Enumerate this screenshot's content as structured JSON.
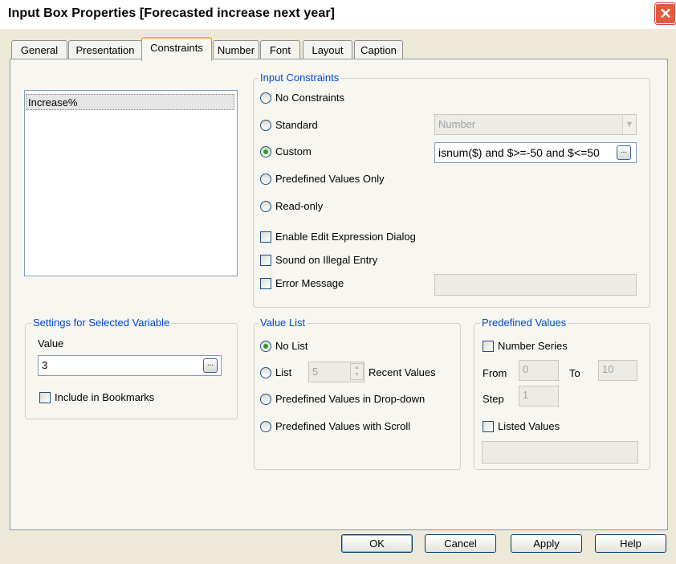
{
  "window": {
    "title": "Input Box Properties [Forecasted increase next year]"
  },
  "tabs": [
    "General",
    "Presentation",
    "Constraints",
    "Number",
    "Font",
    "Layout",
    "Caption"
  ],
  "active_tab": "Constraints",
  "variables_list": {
    "items": [
      "Increase%"
    ],
    "selected": "Increase%"
  },
  "input_constraints": {
    "title": "Input Constraints",
    "options": [
      {
        "label": "No Constraints",
        "checked": false
      },
      {
        "label": "Standard",
        "checked": false
      },
      {
        "label": "Custom",
        "checked": true
      },
      {
        "label": "Predefined Values Only",
        "checked": false
      },
      {
        "label": "Read-only",
        "checked": false
      }
    ],
    "standard_value": "Number",
    "custom_expression": "isnum($) and $>=-50 and  $<=50",
    "checkboxes": [
      {
        "label": "Enable Edit Expression Dialog",
        "checked": false
      },
      {
        "label": "Sound on Illegal Entry",
        "checked": false
      },
      {
        "label": "Error Message",
        "checked": false
      }
    ],
    "error_message_value": ""
  },
  "settings_selected_variable": {
    "title": "Settings for Selected Variable",
    "value_label": "Value",
    "value": "3",
    "include_in_bookmarks_label": "Include in Bookmarks",
    "include_in_bookmarks": false
  },
  "value_list": {
    "title": "Value List",
    "options": [
      {
        "label": "No List",
        "checked": true
      },
      {
        "label": "List",
        "checked": false
      },
      {
        "label": "Predefined Values in Drop-down",
        "checked": false
      },
      {
        "label": "Predefined Values with Scroll",
        "checked": false
      }
    ],
    "recent_count": "5",
    "recent_values_label": "Recent Values"
  },
  "predefined_values": {
    "title": "Predefined Values",
    "number_series_label": "Number Series",
    "number_series": false,
    "from_label": "From",
    "from_value": "0",
    "to_label": "To",
    "to_value": "10",
    "step_label": "Step",
    "step_value": "1",
    "listed_values_label": "Listed Values",
    "listed_values": false,
    "listed_values_value": ""
  },
  "buttons": {
    "ok": "OK",
    "cancel": "Cancel",
    "apply": "Apply",
    "help": "Help"
  },
  "icons": {
    "close": "close-icon",
    "ellipsis": "ellipsis-icon",
    "dropdown": "chevron-down-icon"
  },
  "colors": {
    "accent": "#0046d5",
    "radio_dot": "#21a121",
    "close": "#e35b3c"
  }
}
